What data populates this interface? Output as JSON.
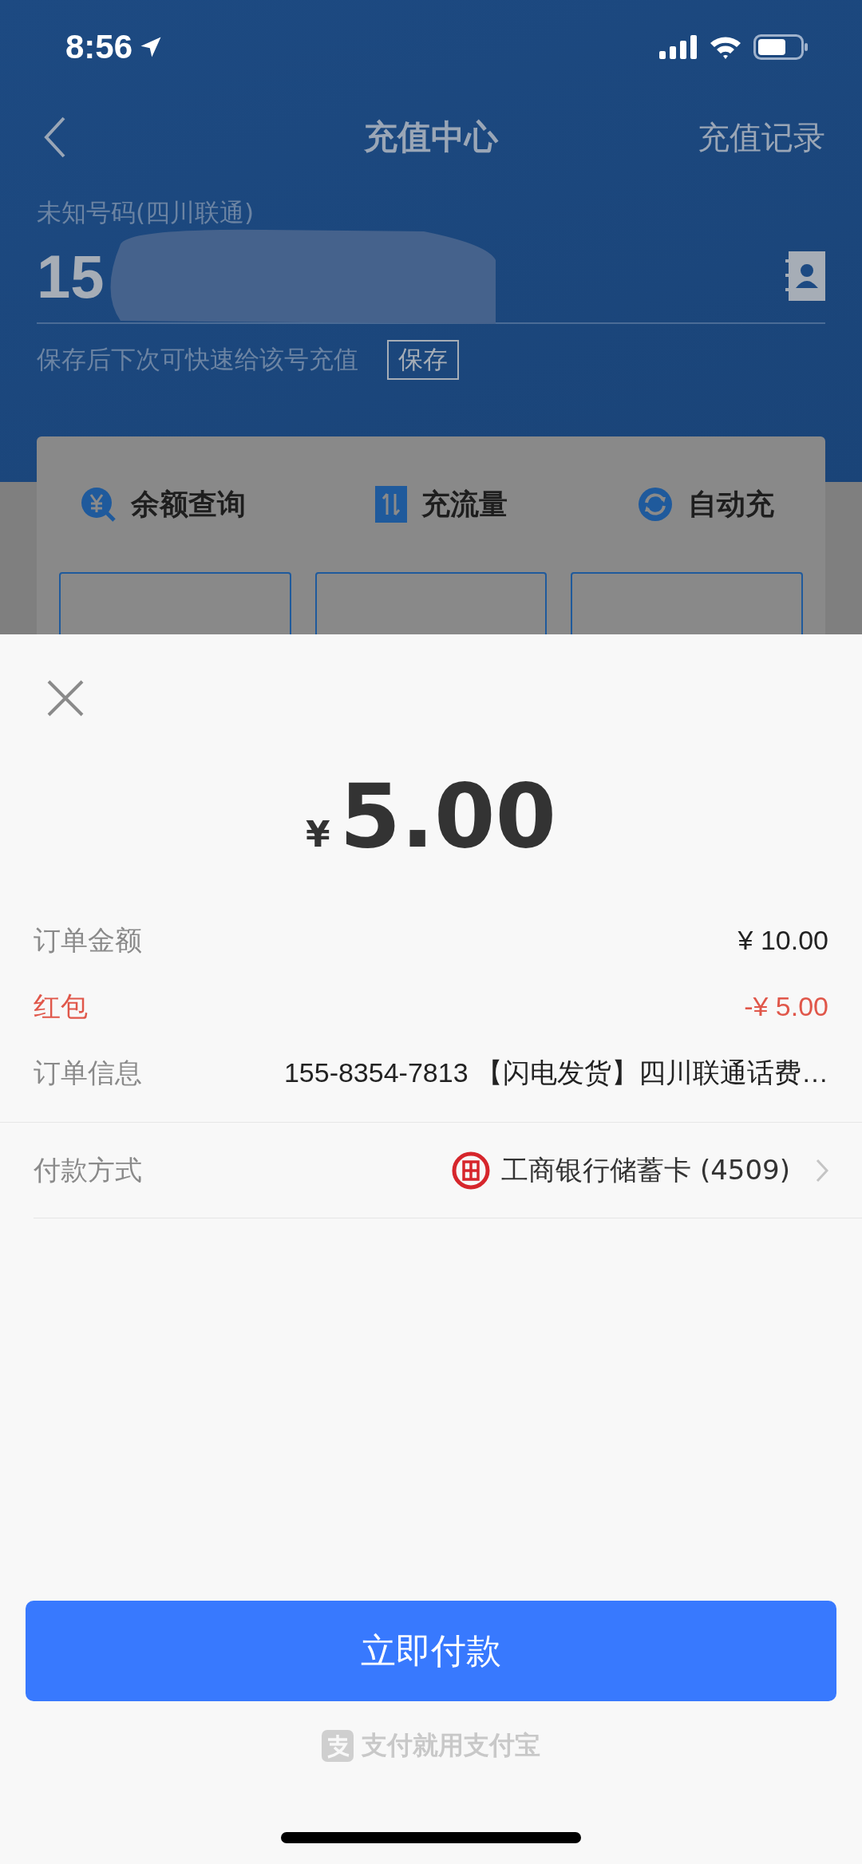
{
  "status_bar": {
    "time": "8:56"
  },
  "nav": {
    "title": "充值中心",
    "action": "充值记录"
  },
  "phone": {
    "label": "未知号码(四川联通)",
    "value": "15",
    "save_hint": "保存后下次可快速给该号充值",
    "save_button": "保存"
  },
  "tabs": [
    {
      "label": "余额查询",
      "kind": "balance"
    },
    {
      "label": "充流量",
      "kind": "data"
    },
    {
      "label": "自动充",
      "kind": "auto"
    }
  ],
  "payment": {
    "symbol": "¥",
    "amount": "5.00",
    "rows": [
      {
        "label": "订单金额",
        "value": "¥ 10.00",
        "kind": "normal"
      },
      {
        "label": "红包",
        "value": "-¥ 5.00",
        "kind": "discount"
      },
      {
        "label": "订单信息",
        "value": "155-8354-7813 【闪电发货】四川联通话费…",
        "kind": "info"
      }
    ],
    "method": {
      "label": "付款方式",
      "value": "工商银行储蓄卡 (4509)"
    },
    "pay_button": "立即付款",
    "footer": "支付就用支付宝"
  }
}
